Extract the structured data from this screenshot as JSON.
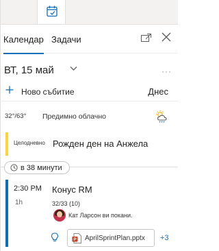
{
  "app": {
    "icon": "calendar-check-icon",
    "accent": "#0f6cbd"
  },
  "tabs": [
    {
      "label": "Календар",
      "active": true
    },
    {
      "label": "Задачи",
      "active": false
    }
  ],
  "header": {
    "date": "ВТ, 15 май"
  },
  "actions": {
    "new_event": "Ново събитие",
    "today": "Днес"
  },
  "weather": {
    "temp": "32°/63°",
    "condition": "Предимно облачно",
    "icon": "partly-cloudy-rain-icon"
  },
  "all_day_event": {
    "label": "Целодневно",
    "title": "Рожден ден на Анжела",
    "color": "#ffd335"
  },
  "time_chip": "в 38 минути",
  "event": {
    "time": "2:30 PM",
    "duration": "1h",
    "title": "Конус RM",
    "count": "32/33 (10)",
    "invite": "Кат Ларсон ви покани.",
    "attachment": "AprilSprintPlan.pptx",
    "more": "+3",
    "color": "#0f6cbd"
  }
}
